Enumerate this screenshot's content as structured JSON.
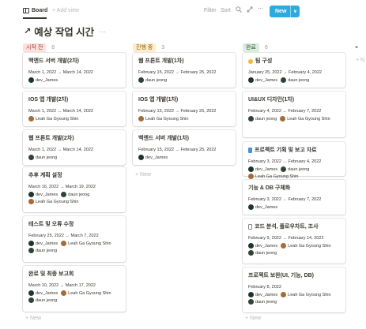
{
  "toolbar": {
    "view_tab": "Board",
    "add_view": "+ Add view",
    "filter": "Filter",
    "sort": "Sort",
    "search_icon": "search-icon",
    "expand_icon": "expand-icon",
    "more": "···",
    "new_button": "New",
    "new_caret": "∨"
  },
  "page": {
    "title": "예상 작업 시간",
    "title_icon": "↗",
    "more": "···"
  },
  "colors": {
    "tag_todo_bg": "#fddfdc",
    "tag_todo_fg": "#9f3a32",
    "tag_doing_bg": "#fdecc8",
    "tag_doing_fg": "#8d5c14",
    "tag_done_bg": "#dbeddb",
    "tag_done_fg": "#2b593f",
    "accent": "#2eaadc",
    "avatar_dev_james": "#1f3330",
    "avatar_daun": "#2f4436",
    "avatar_leah": "#a76b38"
  },
  "columns": [
    {
      "tag": "시작 전",
      "count": "6",
      "add_new": "+ New",
      "cards": [
        {
          "title": "백엔드 서버 개발(2차)",
          "date": "March 1, 2022 → March 14, 2022",
          "people": [
            "dev_James"
          ]
        },
        {
          "title": "IOS 앱 개발(2차)",
          "date": "March 1, 2022 → March 14, 2022",
          "people": [
            "Leah Ga Gyoung Shin"
          ]
        },
        {
          "title": "웹 프론트 개발(2차)",
          "date": "March 1, 2022 → March 14, 2022",
          "people": [
            "daun jeong"
          ]
        },
        {
          "title": "추후 계획 설정",
          "date": "March 16, 2022 → March 19, 2022",
          "people": [
            "dev_James",
            "daun jeong",
            "Leah Ga Gyoung Shin"
          ]
        },
        {
          "title": "테스트 및 오류 수정",
          "date": "February 25, 2022 → March 7, 2022",
          "people": [
            "dev_James",
            "Leah Ga Gyoung Shin",
            "daun jeong"
          ]
        },
        {
          "title": "완료 및 최종 보고회",
          "date": "March 10, 2022 → March 17, 2022",
          "people": [
            "dev_James",
            "Leah Ga Gyoung Shin",
            "daun jeong"
          ]
        }
      ]
    },
    {
      "tag": "진행 중",
      "count": "3",
      "add_new": "+ New",
      "cards": [
        {
          "title": "웹 프론트 개발(1차)",
          "date": "February 15, 2022 → February 25, 2022",
          "people": [
            "daun jeong"
          ]
        },
        {
          "title": "IOS 앱 개발(1차)",
          "date": "February 15, 2022 → February 25, 2022",
          "people": [
            "Leah Ga Gyoung Shin"
          ]
        },
        {
          "title": "백엔드 서버 개발(1차)",
          "date": "February 15, 2022 → February 25, 2022",
          "people": [
            "dev_James"
          ]
        }
      ]
    },
    {
      "tag": "완료",
      "count": "6",
      "add_new": "+ New",
      "cards": [
        {
          "title": "팀 구성",
          "icon": "dot-icon",
          "date": "January 25, 2022 → February 4, 2022",
          "people": [
            "dev_James",
            "daun jeong"
          ]
        },
        {
          "title": "UI&UX 디자인(1차)",
          "date": "February 4, 2022 → February 7, 2022",
          "people": [
            "daun jeong",
            "Leah Ga Gyoung Shin"
          ]
        },
        {
          "title": "프로젝트 기획 및 보고 자료",
          "icon": "blue-doc-icon",
          "date": "February 3, 2022 → February 4, 2022",
          "people": [
            "dev_James",
            "daun jeong",
            "Leah Ga Gyoung Shin"
          ]
        },
        {
          "title": "기능 & DB 구체화",
          "date": "February 3, 2022 → February 7, 2022",
          "people": [
            "dev_James"
          ]
        },
        {
          "title": "코드 분석, 플로우차트, 조사",
          "icon": "doc-icon",
          "date": "February 9, 2022 → February 14, 2022",
          "people": [
            "dev_James",
            "Leah Ga Gyoung Shin",
            "daun jeong"
          ]
        },
        {
          "title": "프로젝트 보완(UI, 기능, DB)",
          "date": "February 8, 2022",
          "people": [
            "dev_James",
            "Leah Ga Gyoung Shin",
            "daun jeong"
          ]
        }
      ]
    }
  ],
  "next_column_fragment": {
    "icon": "◒",
    "add": "+ N"
  }
}
